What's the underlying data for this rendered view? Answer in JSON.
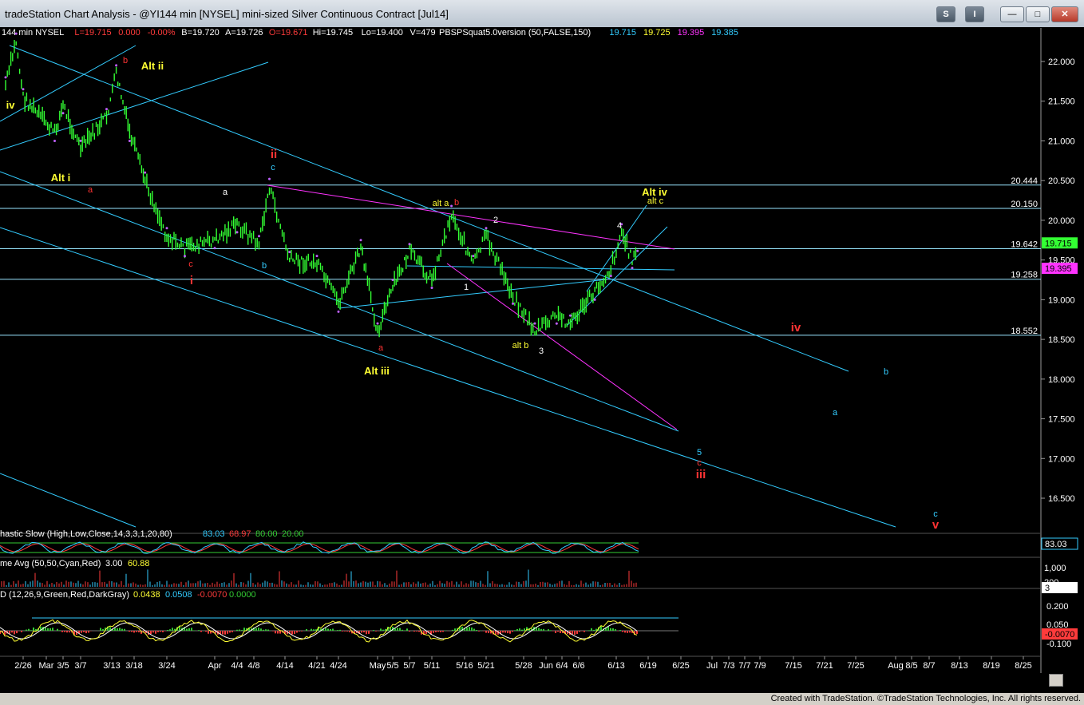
{
  "window": {
    "title": "tradeStation Chart Analysis - @YI144 min [NYSEL] mini-sized Silver Continuous Contract [Jul14]",
    "buttons": [
      "S",
      "I",
      "—",
      "□",
      "✕"
    ]
  },
  "header": {
    "segments": [
      {
        "text": "144 min  NYSEL",
        "color": "#ffffff"
      },
      {
        "text": "L=19.715",
        "color": "#ff3b3b"
      },
      {
        "text": "0.000",
        "color": "#ff3b3b"
      },
      {
        "text": "-0.00%",
        "color": "#ff3b3b"
      },
      {
        "text": "B=19.720",
        "color": "#ffffff"
      },
      {
        "text": "A=19.726",
        "color": "#ffffff"
      },
      {
        "text": "O=19.671",
        "color": "#ff3b3b"
      },
      {
        "text": "Hi=19.745",
        "color": "#ffffff"
      },
      {
        "text": "Lo=19.400",
        "color": "#ffffff"
      },
      {
        "text": "V=479",
        "color": "#ffffff"
      },
      {
        "text": "PBSPSquat5.0version (50,FALSE,150)",
        "color": "#ffffff"
      },
      {
        "text": "19.715",
        "color": "#33ccff"
      },
      {
        "text": "19.725",
        "color": "#ffff33"
      },
      {
        "text": "19.395",
        "color": "#ff33ff"
      },
      {
        "text": "19.385",
        "color": "#33ccff"
      }
    ]
  },
  "price_axis": {
    "ticks": [
      "22.000",
      "21.500",
      "21.000",
      "20.500",
      "20.000",
      "19.500",
      "19.000",
      "18.500",
      "18.000",
      "17.500",
      "17.000",
      "16.500"
    ],
    "level_labels": [
      "20.444",
      "20.150",
      "19.642",
      "19.258",
      "18.552"
    ],
    "last_price_badge": "19.715",
    "indicator_badge": "19.395"
  },
  "date_axis": {
    "labels": [
      "2/26",
      "Mar",
      "3/5",
      "3/7",
      "3/13",
      "3/18",
      "3/24",
      "Apr",
      "4/4",
      "4/8",
      "4/14",
      "4/21",
      "4/24",
      "May",
      "5/5",
      "5/7",
      "5/11",
      "5/16",
      "5/21",
      "5/28",
      "Jun",
      "6/4",
      "6/6",
      "6/13",
      "6/19",
      "6/25",
      "Jul",
      "7/3",
      "7/7",
      "7/9",
      "7/15",
      "7/21",
      "7/25",
      "Aug",
      "8/5",
      "8/7",
      "8/13",
      "8/19",
      "8/25"
    ]
  },
  "wave_labels": [
    {
      "text": "iv",
      "color": "#ffff33"
    },
    {
      "text": "b",
      "color": "#ff3333"
    },
    {
      "text": "Alt ii",
      "color": "#ffff33"
    },
    {
      "text": "Alt i",
      "color": "#ffff33"
    },
    {
      "text": "a",
      "color": "#ff3333"
    },
    {
      "text": "ii",
      "color": "#ff3333"
    },
    {
      "text": "c",
      "color": "#33ccff"
    },
    {
      "text": "a",
      "color": "#ffffff"
    },
    {
      "text": "b",
      "color": "#33ccff"
    },
    {
      "text": "c",
      "color": "#ff3333"
    },
    {
      "text": "i",
      "color": "#ff3333"
    },
    {
      "text": "a",
      "color": "#ff3333"
    },
    {
      "text": "Alt iii",
      "color": "#ffff33"
    },
    {
      "text": "alt a",
      "color": "#ffff33"
    },
    {
      "text": "b",
      "color": "#ff3333"
    },
    {
      "text": "1",
      "color": "#ffffff"
    },
    {
      "text": "2",
      "color": "#ffffff"
    },
    {
      "text": "alt b",
      "color": "#ffff33"
    },
    {
      "text": "3",
      "color": "#ffffff"
    },
    {
      "text": "4",
      "color": "#ffffff"
    },
    {
      "text": "Alt iv",
      "color": "#ffff33"
    },
    {
      "text": "alt c",
      "color": "#ffff33"
    },
    {
      "text": "iv",
      "color": "#ff3333"
    },
    {
      "text": "b",
      "color": "#33ccff"
    },
    {
      "text": "a",
      "color": "#33ccff"
    },
    {
      "text": "5",
      "color": "#33ccff"
    },
    {
      "text": "c",
      "color": "#ff3333"
    },
    {
      "text": "iii",
      "color": "#ff3333"
    },
    {
      "text": "c",
      "color": "#33ccff"
    },
    {
      "text": "v",
      "color": "#ff3333"
    }
  ],
  "indicators": {
    "stochastic": {
      "label": "hastic Slow (High,Low,Close,14,3,3,1,20,80)",
      "values": [
        {
          "text": "83.03",
          "color": "#33ccff"
        },
        {
          "text": "68.97",
          "color": "#ff3b3b"
        },
        {
          "text": "80.00",
          "color": "#33cc33"
        },
        {
          "text": "20.00",
          "color": "#33cc33"
        }
      ],
      "badge": "83.03"
    },
    "volume": {
      "label": "me Avg (50,50,Cyan,Red)",
      "values": [
        {
          "text": "3.00",
          "color": "#ffffff"
        },
        {
          "text": "60.88",
          "color": "#ffff33"
        }
      ],
      "ticks": [
        "1,000",
        "200"
      ],
      "badge": "3"
    },
    "macd": {
      "label": "D (12,26,9,Green,Red,DarkGray)",
      "values": [
        {
          "text": "0.0438",
          "color": "#ffff33"
        },
        {
          "text": "0.0508",
          "color": "#33ccff"
        },
        {
          "text": "-0.0070",
          "color": "#ff3b3b"
        },
        {
          "text": "0.0000",
          "color": "#33cc33"
        }
      ],
      "ticks": [
        "0.200",
        "0.050",
        "-0.100"
      ],
      "badge": "-0.0070"
    }
  },
  "footer": {
    "credit": "Created with TradeStation. ©TradeStation Technologies, Inc. All rights reserved."
  },
  "colors": {
    "background": "#000000",
    "candle": "#33ff33",
    "channel": "#33ccff",
    "magenta_line": "#ff33ff",
    "level_line": "#99e6ff"
  },
  "chart_data": {
    "type": "candlestick",
    "title": "",
    "instrument": "@YI 144 min mini-sized Silver Continuous Contract [Jul14]",
    "x_range": [
      "2/21",
      "8/30"
    ],
    "ylim": [
      16.1,
      22.4
    ],
    "horizontal_levels": [
      20.444,
      20.15,
      19.642,
      19.258,
      18.552
    ],
    "close_path": [
      {
        "date": "2/21",
        "price": 21.7
      },
      {
        "date": "2/24",
        "price": 22.25
      },
      {
        "date": "2/26",
        "price": 21.55
      },
      {
        "date": "3/3",
        "price": 21.1
      },
      {
        "date": "3/5",
        "price": 21.45
      },
      {
        "date": "3/7",
        "price": 20.9
      },
      {
        "date": "3/12",
        "price": 21.3
      },
      {
        "date": "3/14",
        "price": 21.85
      },
      {
        "date": "3/17",
        "price": 21.1
      },
      {
        "date": "3/20",
        "price": 20.5
      },
      {
        "date": "3/24",
        "price": 19.8
      },
      {
        "date": "3/27",
        "price": 19.65
      },
      {
        "date": "4/1",
        "price": 19.75
      },
      {
        "date": "4/4",
        "price": 19.95
      },
      {
        "date": "4/9",
        "price": 19.7
      },
      {
        "date": "4/11",
        "price": 20.42
      },
      {
        "date": "4/15",
        "price": 19.5
      },
      {
        "date": "4/21",
        "price": 19.45
      },
      {
        "date": "4/24",
        "price": 18.95
      },
      {
        "date": "4/28",
        "price": 19.65
      },
      {
        "date": "5/1",
        "price": 18.6
      },
      {
        "date": "5/5",
        "price": 19.15
      },
      {
        "date": "5/7",
        "price": 19.6
      },
      {
        "date": "5/11",
        "price": 19.25
      },
      {
        "date": "5/14",
        "price": 20.08
      },
      {
        "date": "5/18",
        "price": 19.45
      },
      {
        "date": "5/21",
        "price": 19.8
      },
      {
        "date": "5/26",
        "price": 19.05
      },
      {
        "date": "5/30",
        "price": 18.6
      },
      {
        "date": "6/3",
        "price": 18.8
      },
      {
        "date": "6/5",
        "price": 18.7
      },
      {
        "date": "6/9",
        "price": 19.1
      },
      {
        "date": "6/12",
        "price": 19.4
      },
      {
        "date": "6/14",
        "price": 19.85
      },
      {
        "date": "6/16",
        "price": 19.5
      },
      {
        "date": "6/17",
        "price": 19.715
      }
    ]
  }
}
